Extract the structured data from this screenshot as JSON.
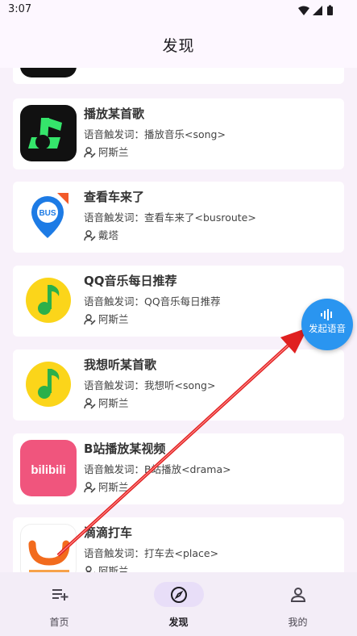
{
  "status_bar": {
    "time": "3:07",
    "icons": [
      "wifi-icon",
      "signal-icon",
      "battery-icon"
    ]
  },
  "app_bar": {
    "title": "发现"
  },
  "cards": [
    {
      "title": "",
      "trigger": "",
      "author": "",
      "icon": "app-icon-partial"
    },
    {
      "title": "播放某首歌",
      "trigger": "语音触发词：播放音乐<song>",
      "author": "阿斯兰",
      "icon": "music-player-icon"
    },
    {
      "title": "查看车来了",
      "trigger": "语音触发词：查看车来了<busroute>",
      "author": "戴塔",
      "icon": "bus-app-icon",
      "icon_text": "BUS"
    },
    {
      "title": "QQ音乐每日推荐",
      "trigger": "语音触发词：QQ音乐每日推荐",
      "author": "阿斯兰",
      "icon": "qq-music-icon"
    },
    {
      "title": "我想听某首歌",
      "trigger": "语音触发词：我想听<song>",
      "author": "阿斯兰",
      "icon": "qq-music-icon"
    },
    {
      "title": "B站播放某视频",
      "trigger": "语音触发词：B站播放<drama>",
      "author": "阿斯兰",
      "icon": "bilibili-icon",
      "icon_text": "bilibili"
    },
    {
      "title": "滴滴打车",
      "trigger": "语音触发词：打车去<place>",
      "author": "阿斯兰",
      "icon": "didi-icon"
    }
  ],
  "fab": {
    "label": "发起语音",
    "icon": "voice-wave-icon"
  },
  "nav": [
    {
      "label": "首页",
      "icon": "playlist-add-icon",
      "active": false
    },
    {
      "label": "发现",
      "icon": "compass-icon",
      "active": true
    },
    {
      "label": "我的",
      "icon": "person-icon",
      "active": false
    }
  ],
  "colors": {
    "accent": "#2a95f0",
    "arrow": "#e02020",
    "background": "#f8f1fa",
    "nav_active_pill": "#e8def8"
  }
}
